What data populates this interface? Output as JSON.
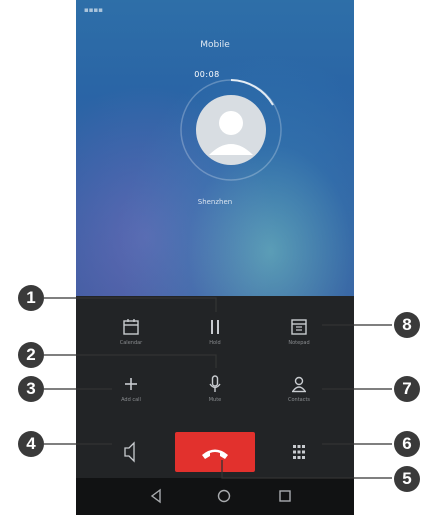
{
  "status_bar": {
    "left_text": "▪▪▪▪"
  },
  "call": {
    "carrier_label": "Mobile",
    "timer": "00:08",
    "location": "Shenzhen"
  },
  "controls": {
    "calendar": {
      "label": "Calendar",
      "icon": "calendar-icon"
    },
    "hold": {
      "label": "Hold",
      "icon": "pause-icon"
    },
    "notepad": {
      "label": "Notepad",
      "icon": "notepad-icon"
    },
    "add_call": {
      "label": "Add call",
      "icon": "plus-icon"
    },
    "mute": {
      "label": "Mute",
      "icon": "microphone-icon"
    },
    "contacts": {
      "label": "Contacts",
      "icon": "contact-icon"
    },
    "speaker": {
      "label": "",
      "icon": "speaker-icon"
    },
    "end_call": {
      "label": "",
      "icon": "phone-hangup-icon"
    },
    "dialpad": {
      "label": "",
      "icon": "dialpad-icon"
    }
  },
  "navbar": {
    "back": "back-icon",
    "home": "home-icon",
    "recents": "recents-icon"
  },
  "callouts": [
    "1",
    "2",
    "3",
    "4",
    "5",
    "6",
    "7",
    "8"
  ],
  "colors": {
    "end_call_red": "#e2312d",
    "panel_bg": "#222426",
    "badge_bg": "#3a3a3a",
    "wallpaper_blue": "#2e6fa8"
  }
}
